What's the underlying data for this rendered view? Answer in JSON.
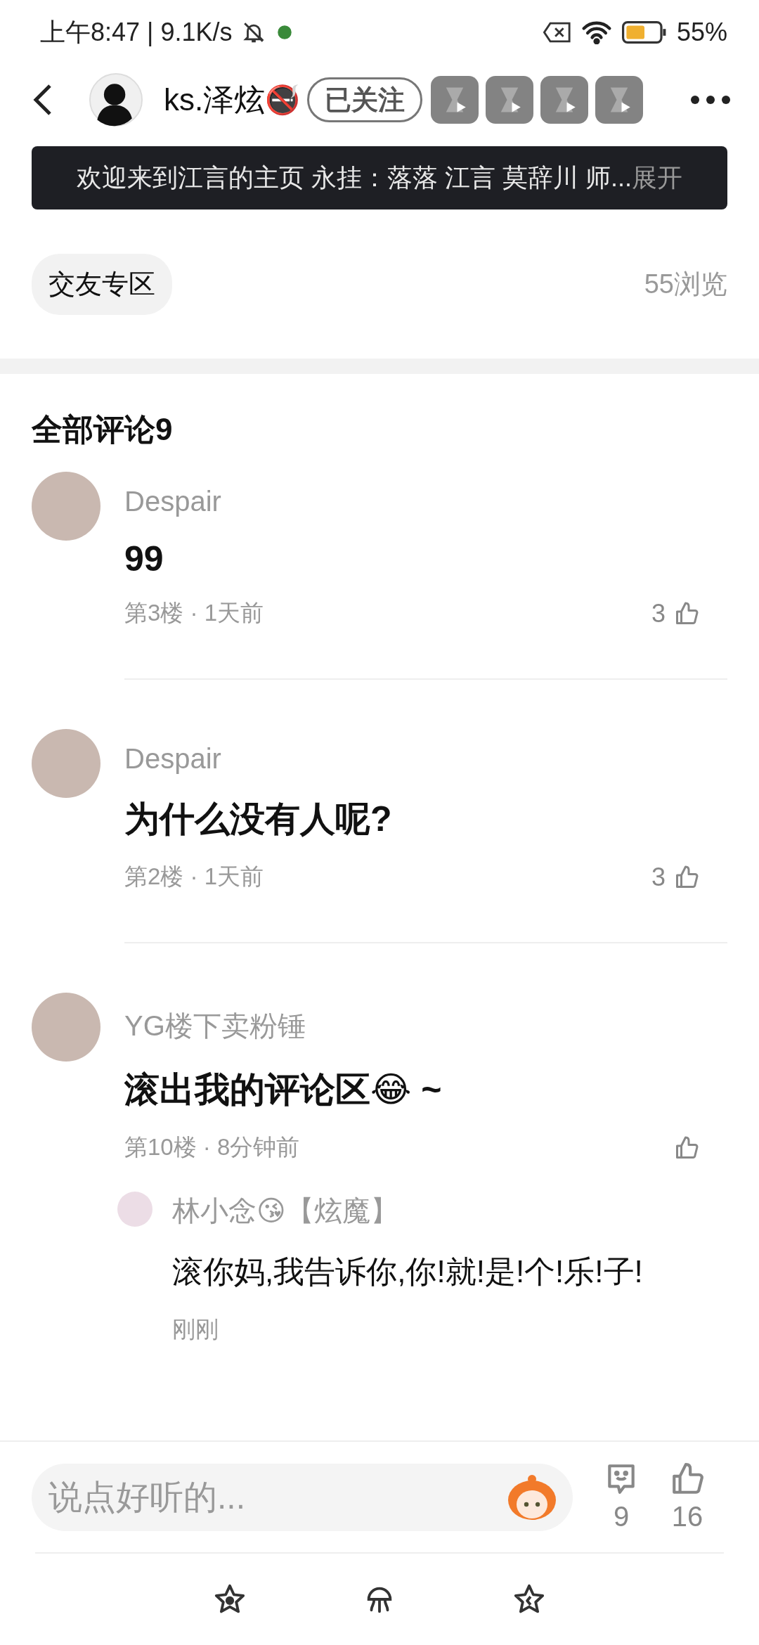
{
  "status_bar": {
    "time_speed": "上午8:47 | 9.1K/s",
    "battery_text": "55%"
  },
  "header": {
    "username": "ks.泽炫",
    "name_badge": "🚭",
    "follow_label": "已关注"
  },
  "banner": {
    "text": "欢迎来到江言的主页 永挂：落落 江言 莫辞川 师...",
    "expand": "展开"
  },
  "topic": {
    "tag": "交友专区",
    "views": "55浏览"
  },
  "comments_title": "全部评论9",
  "comments": [
    {
      "name": "Despair",
      "content": "99",
      "meta": "第3楼 · 1天前",
      "likes": "3"
    },
    {
      "name": "Despair",
      "content": "为什么没有人呢?",
      "meta": "第2楼 · 1天前",
      "likes": "3"
    },
    {
      "name": "YG楼下卖粉锤",
      "content": "滚出我的评论区😂 ~",
      "meta": "第10楼 · 8分钟前",
      "replies": [
        {
          "name": "林小念😘【炫魔】",
          "content": "滚你妈,我告诉你,你!就!是!个!乐!子!",
          "meta": "刚刚"
        }
      ]
    }
  ],
  "input": {
    "placeholder": "说点好听的..."
  },
  "counts": {
    "comments": "9",
    "likes": "16"
  }
}
